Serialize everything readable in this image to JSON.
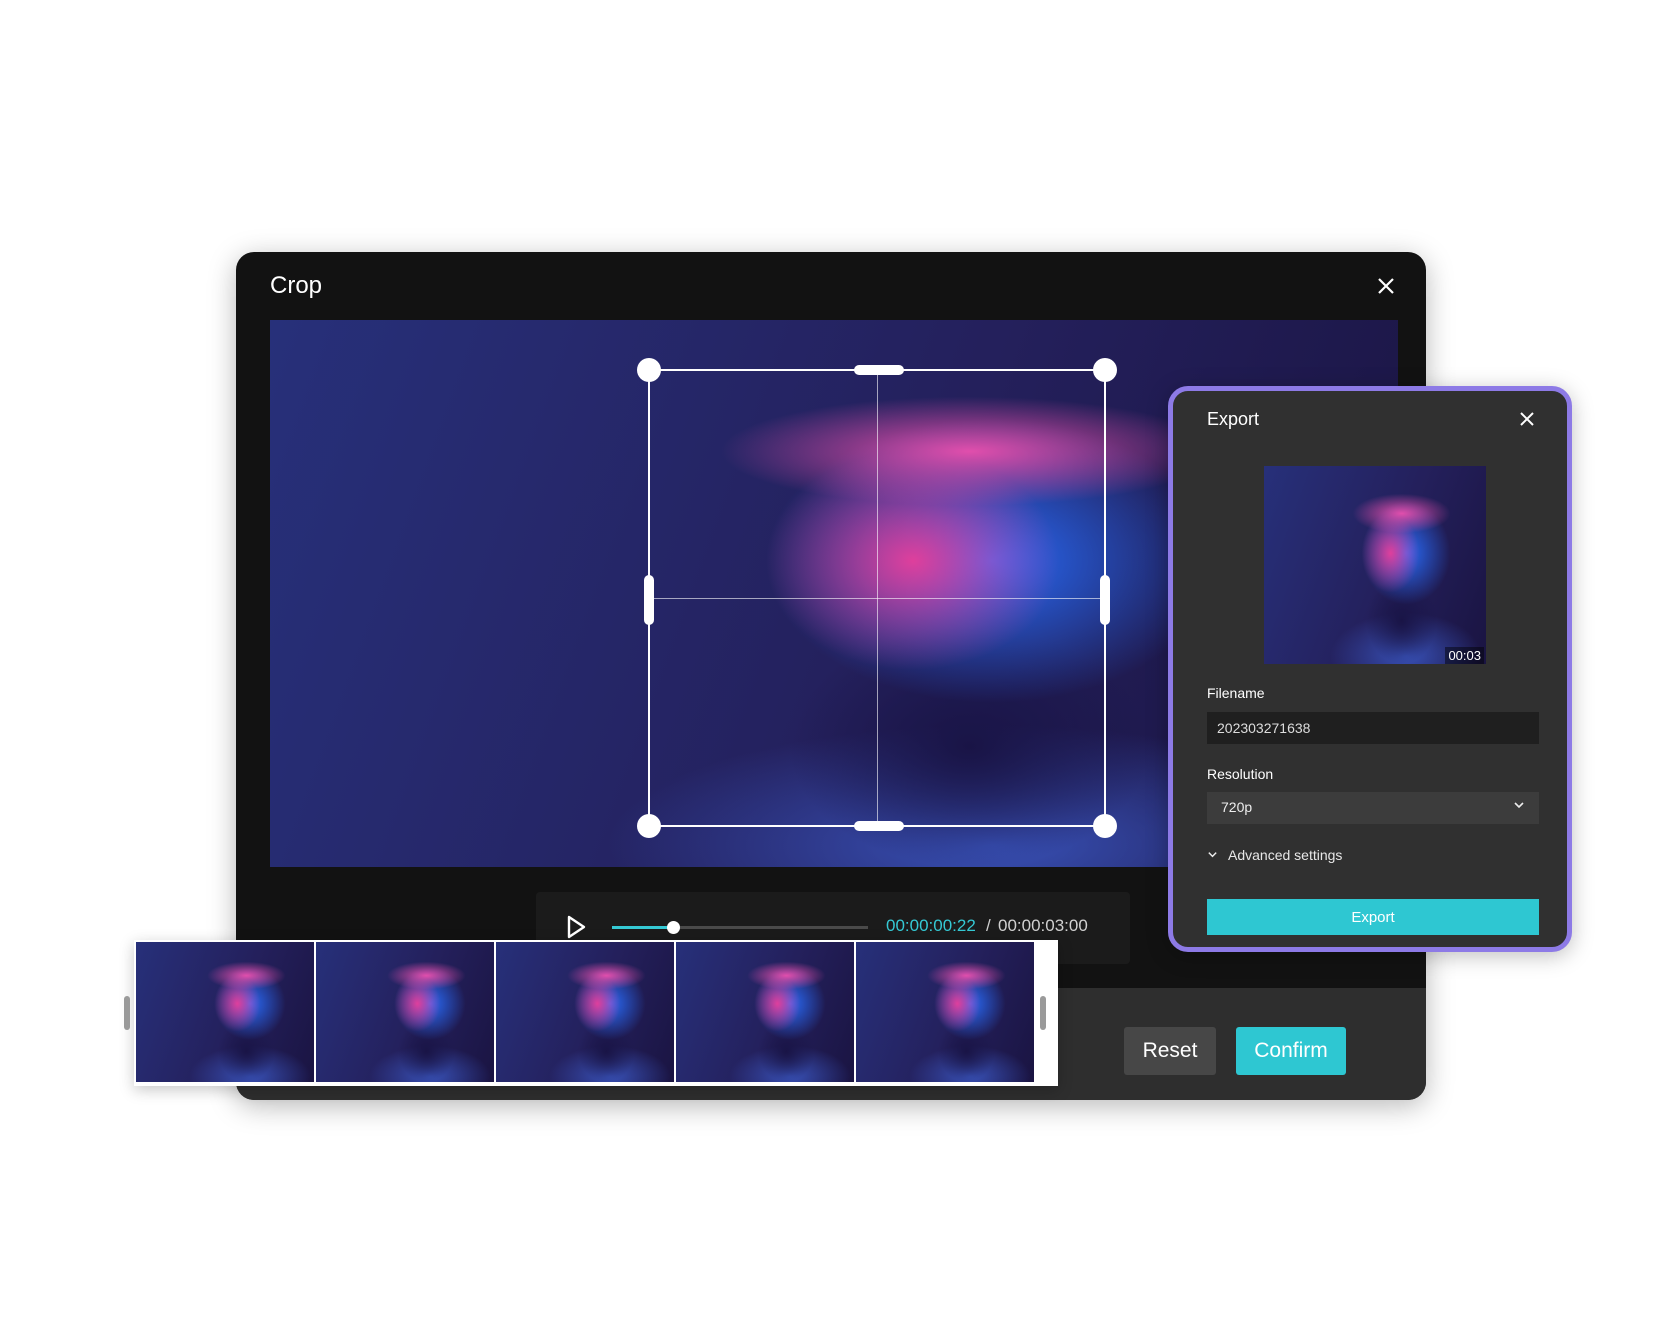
{
  "crop": {
    "title": "Crop",
    "close_icon": "close-icon",
    "playback": {
      "play_icon": "play-icon",
      "progress_fraction": 0.24,
      "current_time": "00:00:00:22",
      "separator": "/",
      "total_time": "00:00:03:00"
    },
    "buttons": {
      "reset": "Reset",
      "confirm": "Confirm"
    }
  },
  "filmstrip": {
    "frame_count": 5
  },
  "export": {
    "title": "Export",
    "close_icon": "close-icon",
    "thumbnail_duration": "00:03",
    "filename_label": "Filename",
    "filename_value": "202303271638",
    "resolution_label": "Resolution",
    "resolution_value": "720p",
    "advanced_settings": "Advanced settings",
    "export_button": "Export"
  },
  "colors": {
    "accent": "#2ec7d2",
    "panel_border": "#8d7ae6",
    "window_bg": "#121212"
  }
}
